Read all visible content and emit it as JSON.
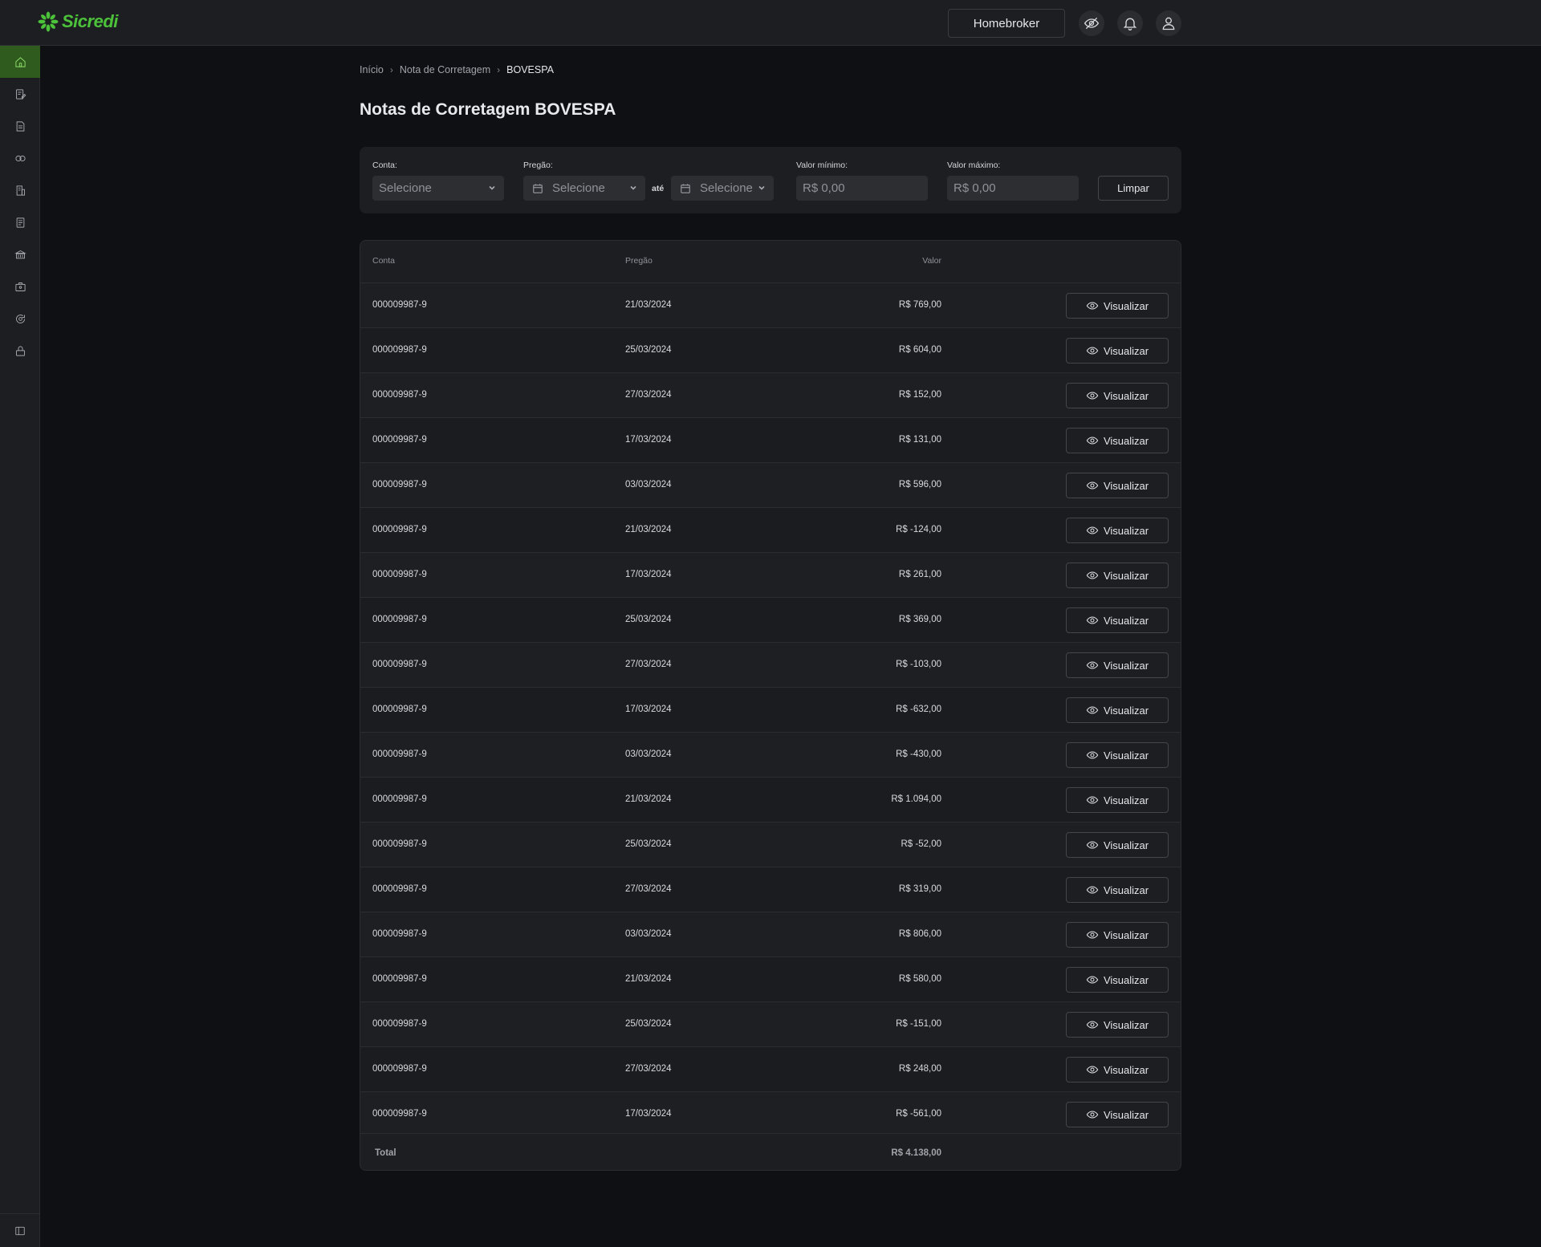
{
  "app": {
    "brand": "Sicredi",
    "brand_color": "#4cc23a"
  },
  "header": {
    "homebroker_label": "Homebroker",
    "icons": [
      "eye-off-icon",
      "bell-icon",
      "user-icon"
    ]
  },
  "sidebar": {
    "items": [
      {
        "icon": "home-icon",
        "active": true
      },
      {
        "icon": "document-edit-icon",
        "active": false
      },
      {
        "icon": "document-icon",
        "active": false
      },
      {
        "icon": "exchange-icon",
        "active": false
      },
      {
        "icon": "building-icon",
        "active": false
      },
      {
        "icon": "receipt-icon",
        "active": false
      },
      {
        "icon": "bank-icon",
        "active": false
      },
      {
        "icon": "briefcase-icon",
        "active": false
      },
      {
        "icon": "refresh-icon",
        "active": false
      },
      {
        "icon": "lock-icon",
        "active": false
      }
    ],
    "collapse_icon": "sidebar-toggle-icon"
  },
  "breadcrumb": {
    "items": [
      "Início",
      "Nota de Corretagem",
      "BOVESPA"
    ]
  },
  "page": {
    "title": "Notas de Corretagem BOVESPA"
  },
  "filters": {
    "conta": {
      "label": "Conta:",
      "placeholder": "Selecione"
    },
    "pregao": {
      "label": "Pregão:",
      "from_placeholder": "Selecione",
      "separator": "até",
      "to_placeholder": "Selecione"
    },
    "valor_minimo": {
      "label": "Valor mínimo:",
      "placeholder": "R$ 0,00"
    },
    "valor_maximo": {
      "label": "Valor máximo:",
      "placeholder": "R$ 0,00"
    },
    "clear_label": "Limpar"
  },
  "table": {
    "headers": {
      "conta": "Conta",
      "pregao": "Pregão",
      "valor": "Valor"
    },
    "action_label": "Visualizar",
    "rows": [
      {
        "conta": "000009987-9",
        "pregao": "21/03/2024",
        "valor": "R$ 769,00"
      },
      {
        "conta": "000009987-9",
        "pregao": "25/03/2024",
        "valor": "R$ 604,00"
      },
      {
        "conta": "000009987-9",
        "pregao": "27/03/2024",
        "valor": "R$ 152,00"
      },
      {
        "conta": "000009987-9",
        "pregao": "17/03/2024",
        "valor": "R$ 131,00"
      },
      {
        "conta": "000009987-9",
        "pregao": "03/03/2024",
        "valor": "R$ 596,00"
      },
      {
        "conta": "000009987-9",
        "pregao": "21/03/2024",
        "valor": "R$ -124,00"
      },
      {
        "conta": "000009987-9",
        "pregao": "17/03/2024",
        "valor": "R$ 261,00"
      },
      {
        "conta": "000009987-9",
        "pregao": "25/03/2024",
        "valor": "R$ 369,00"
      },
      {
        "conta": "000009987-9",
        "pregao": "27/03/2024",
        "valor": "R$ -103,00"
      },
      {
        "conta": "000009987-9",
        "pregao": "17/03/2024",
        "valor": "R$ -632,00"
      },
      {
        "conta": "000009987-9",
        "pregao": "03/03/2024",
        "valor": "R$ -430,00"
      },
      {
        "conta": "000009987-9",
        "pregao": "21/03/2024",
        "valor": "R$ 1.094,00"
      },
      {
        "conta": "000009987-9",
        "pregao": "25/03/2024",
        "valor": "R$ -52,00"
      },
      {
        "conta": "000009987-9",
        "pregao": "27/03/2024",
        "valor": "R$ 319,00"
      },
      {
        "conta": "000009987-9",
        "pregao": "03/03/2024",
        "valor": "R$ 806,00"
      },
      {
        "conta": "000009987-9",
        "pregao": "21/03/2024",
        "valor": "R$ 580,00"
      },
      {
        "conta": "000009987-9",
        "pregao": "25/03/2024",
        "valor": "R$ -151,00"
      },
      {
        "conta": "000009987-9",
        "pregao": "27/03/2024",
        "valor": "R$ 248,00"
      },
      {
        "conta": "000009987-9",
        "pregao": "17/03/2024",
        "valor": "R$ -561,00"
      }
    ],
    "total": {
      "label": "Total",
      "valor": "R$ 4.138,00"
    }
  }
}
